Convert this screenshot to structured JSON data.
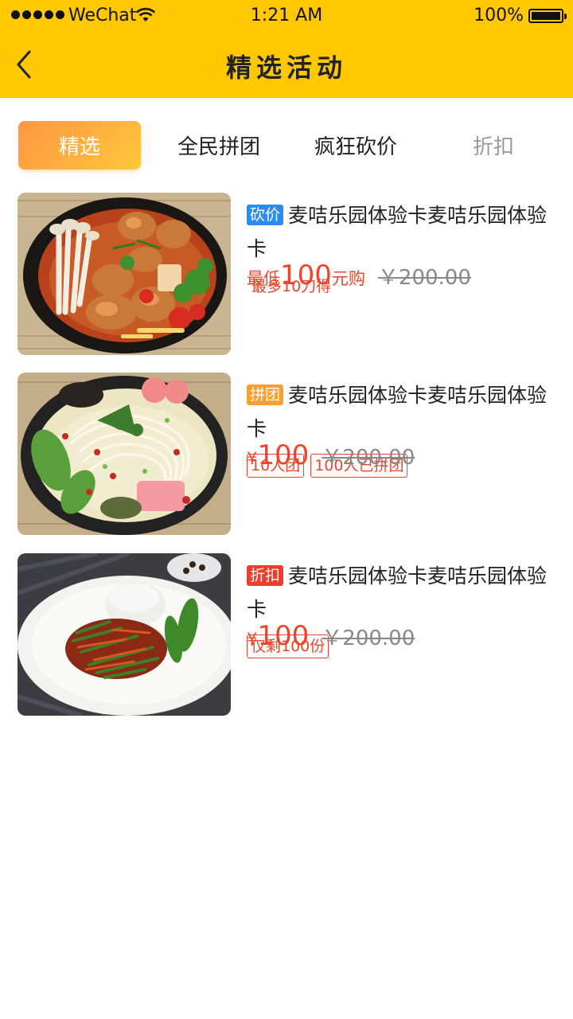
{
  "status_bar": {
    "carrier": "WeChat",
    "time": "1:21 AM",
    "battery": "100%"
  },
  "nav": {
    "title": "精选活动"
  },
  "tabs": [
    {
      "label": "精选",
      "active": true
    },
    {
      "label": "全民拼团",
      "active": false
    },
    {
      "label": "疯狂砍价",
      "active": false
    },
    {
      "label": "折扣",
      "active": false
    }
  ],
  "items": [
    {
      "badge": "砍价",
      "badge_color": "#2A8CF0",
      "title": "麦咭乐园体验卡麦咭乐园体验卡",
      "tag_plain": "最多10刀得",
      "price_prefix": "最低",
      "price": "100",
      "price_suffix": "元购",
      "original_price": "￥200.00",
      "image": "braised-chicken-clay-pot"
    },
    {
      "badge": "拼团",
      "badge_color": "#FF9D2F",
      "title": "麦咭乐园体验卡麦咭乐园体验卡",
      "tags": [
        "10人团",
        "100人已拼团"
      ],
      "currency": "¥",
      "price": "100",
      "original_price": "￥200.00",
      "image": "rice-noodle-soup"
    },
    {
      "badge": "折扣",
      "badge_color": "#F03C2A",
      "title": "麦咭乐园体验卡麦咭乐园体验卡",
      "tags": [
        "仅剩100份"
      ],
      "currency": "¥",
      "price": "100",
      "original_price": "￥200.00",
      "image": "stir-fry-rice-plate"
    }
  ],
  "colors": {
    "brand_yellow": "#FFC800",
    "price_red": "#F0442A",
    "tab_gradient_start": "#FF9544",
    "tab_gradient_end": "#FFC83A"
  }
}
